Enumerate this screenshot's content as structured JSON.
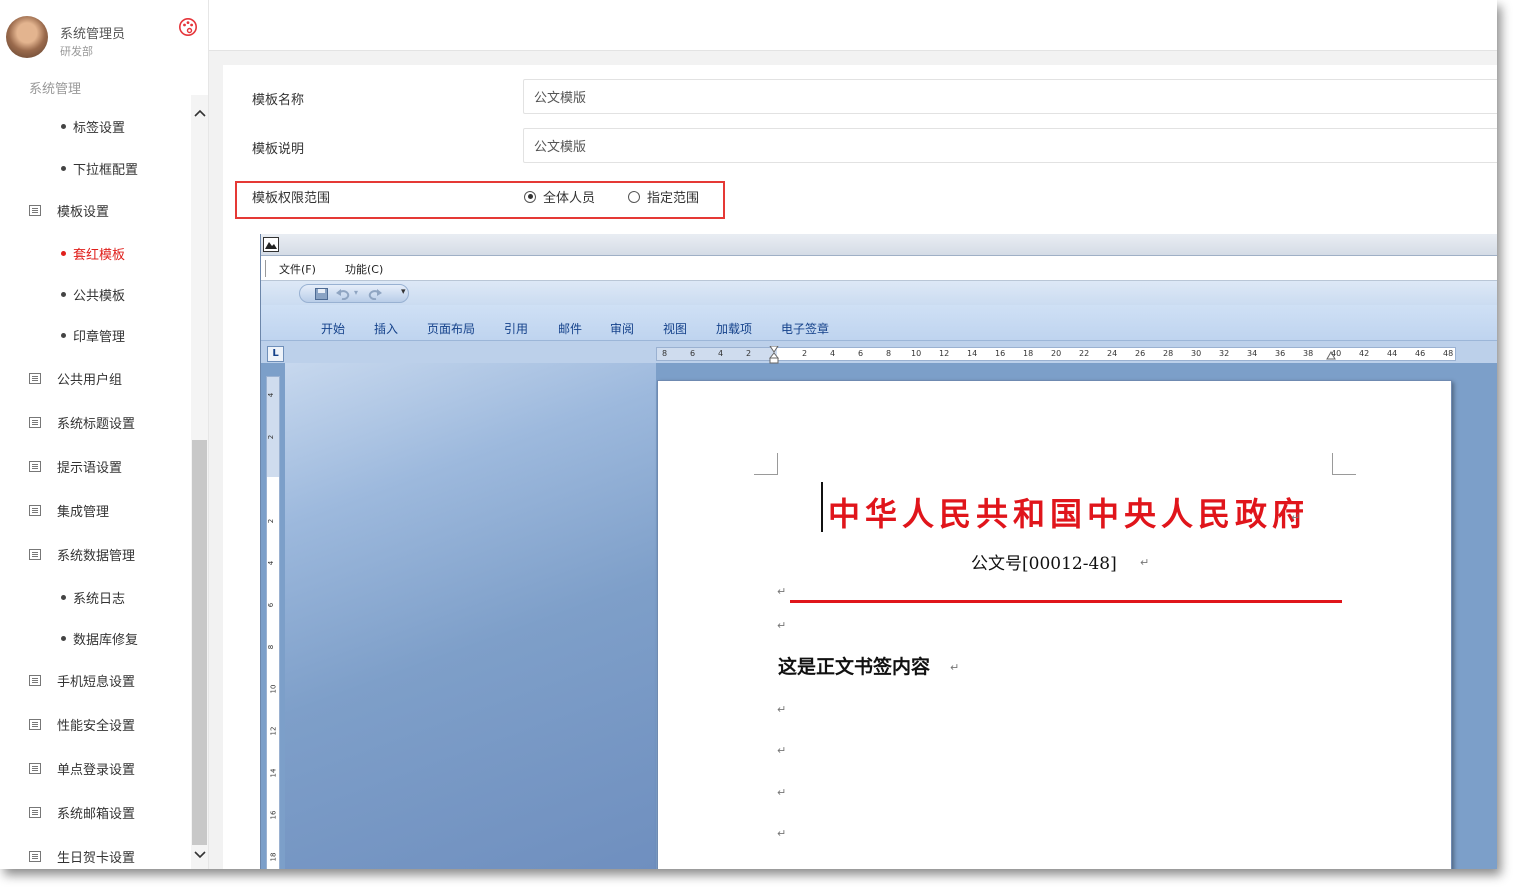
{
  "user": {
    "name": "系统管理员",
    "department": "研发部"
  },
  "sidebar": {
    "section_title": "系统管理",
    "items": [
      {
        "label": "标签设置",
        "type": "sub"
      },
      {
        "label": "下拉框配置",
        "type": "sub"
      },
      {
        "label": "模板设置",
        "type": "top"
      },
      {
        "label": "套红模板",
        "type": "sub",
        "active": true
      },
      {
        "label": "公共模板",
        "type": "sub"
      },
      {
        "label": "印章管理",
        "type": "sub"
      },
      {
        "label": "公共用户组",
        "type": "top"
      },
      {
        "label": "系统标题设置",
        "type": "top"
      },
      {
        "label": "提示语设置",
        "type": "top"
      },
      {
        "label": "集成管理",
        "type": "top"
      },
      {
        "label": "系统数据管理",
        "type": "top"
      },
      {
        "label": "系统日志",
        "type": "sub"
      },
      {
        "label": "数据库修复",
        "type": "sub"
      },
      {
        "label": "手机短息设置",
        "type": "top"
      },
      {
        "label": "性能安全设置",
        "type": "top"
      },
      {
        "label": "单点登录设置",
        "type": "top"
      },
      {
        "label": "系统邮箱设置",
        "type": "top"
      },
      {
        "label": "生日贺卡设置",
        "type": "top"
      }
    ]
  },
  "form": {
    "name_label": "模板名称",
    "name_value": "公文模版",
    "desc_label": "模板说明",
    "desc_value": "公文模版",
    "scope_label": "模板权限范围",
    "scope_options": [
      {
        "label": "全体人员",
        "selected": true
      },
      {
        "label": "指定范围",
        "selected": false
      }
    ]
  },
  "word": {
    "menu": [
      "文件(F)",
      "功能(C)"
    ],
    "ribbon_tabs": [
      "开始",
      "插入",
      "页面布局",
      "引用",
      "邮件",
      "审阅",
      "视图",
      "加载项",
      "电子签章"
    ],
    "ruler_corner": "L",
    "h_ruler_numbers": [
      "8",
      "6",
      "4",
      "2",
      "",
      "2",
      "4",
      "6",
      "8",
      "10",
      "12",
      "14",
      "16",
      "18",
      "20",
      "22",
      "24",
      "26",
      "28",
      "30",
      "32",
      "34",
      "36",
      "38",
      "40",
      "42",
      "44",
      "46",
      "48"
    ],
    "v_ruler_numbers": [
      "4",
      "2",
      "",
      "2",
      "4",
      "6",
      "8",
      "10",
      "12",
      "14",
      "16",
      "18"
    ],
    "document": {
      "title": "中华人民共和国中央人民政府",
      "number": "公文号[00012-48]",
      "body": "这是正文书签内容",
      "paragraph_mark": "↵"
    }
  },
  "colors": {
    "accent": "#e0201c",
    "doc_red": "#e0151b",
    "highlight_box": "#e53935",
    "ribbon_text": "#15428b"
  }
}
